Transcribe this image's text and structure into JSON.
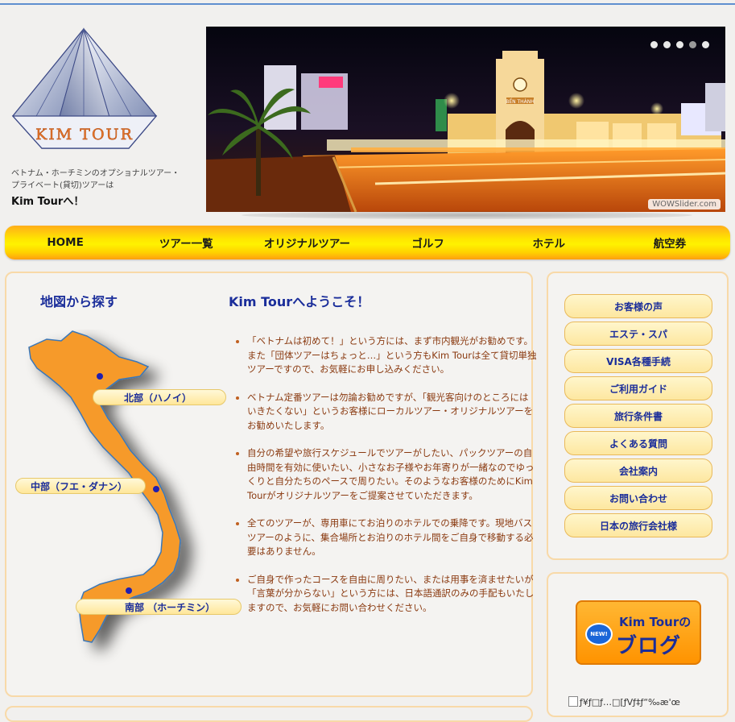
{
  "logo": {
    "text": "KIM TOUR"
  },
  "tagline": {
    "line1": "ベトナム・ホーチミンのオプショナルツアー・",
    "line2": "プライベート(貸切)ツアーは",
    "strong": "Kim Tourへ！"
  },
  "slider": {
    "watermark": "WOWSlider.com",
    "dot_count": 5,
    "active_dot": 4,
    "sign": "BẾN THÀNH"
  },
  "nav": [
    {
      "label": "HOME"
    },
    {
      "label": "ツアー一覧"
    },
    {
      "label": "オリジナルツアー"
    },
    {
      "label": "ゴルフ"
    },
    {
      "label": "ホテル"
    },
    {
      "label": "航空券"
    }
  ],
  "main": {
    "map_title": "地図から探す",
    "welcome_title": "Kim Tourへようこそ！",
    "regions": [
      {
        "label": "北部（ハノイ）"
      },
      {
        "label": "中部（フエ・ダナン）"
      },
      {
        "label": "南部 （ホーチミン）"
      }
    ],
    "paragraphs": [
      "「ベトナムは初めて！」という方には、まず市内観光がお勧めです。また「団体ツアーはちょっと…」という方もKim Tourは全て貸切単独ツアーですので、お気軽にお申し込みください。",
      "ベトナム定番ツアーは勿論お勧めですが、「観光客向けのところにはいきたくない」というお客様にローカルツアー・オリジナルツアーをお勧めいたします。",
      "自分の希望や旅行スケジュールでツアーがしたい、パックツアーの自由時間を有効に使いたい、小さなお子様やお年寄りが一緒なのでゆっくりと自分たちのペースで周りたい。そのようなお客様のためにKim Tourがオリジナルツアーをご提案させていただきます。",
      "全てのツアーが、専用車にてお泊りのホテルでの乗降です。現地バスツアーのように、集合場所とお泊りのホテル間をご自身で移動する必要はありません。",
      "ご自身で作ったコースを自由に周りたい、または用事を済ませたいが「言葉が分からない」という方には、日本語通訳のみの手配もいたしますので、お気軽にお問い合わせください。"
    ]
  },
  "side_menu": [
    {
      "label": "お客様の声"
    },
    {
      "label": "エステ・スパ"
    },
    {
      "label": "VISA各種手続"
    },
    {
      "label": "ご利用ガイド"
    },
    {
      "label": "旅行条件書"
    },
    {
      "label": "よくある質問"
    },
    {
      "label": "会社案内"
    },
    {
      "label": "お問い合わせ"
    },
    {
      "label": "日本の旅行会社様"
    }
  ],
  "blog": {
    "badge": "NEW!",
    "line1": "Kim Tourの",
    "line2": "ブログ"
  },
  "broken_image_alt": "ƒ¥ƒ□ƒ…□[ƒVƒ‡ƒ“‰æ'œ",
  "colors": {
    "nav_top": "#ffe600",
    "accent_blue": "#1a2d9a",
    "panel_border": "#f8d9a8",
    "text_brown": "#8a3a10"
  }
}
